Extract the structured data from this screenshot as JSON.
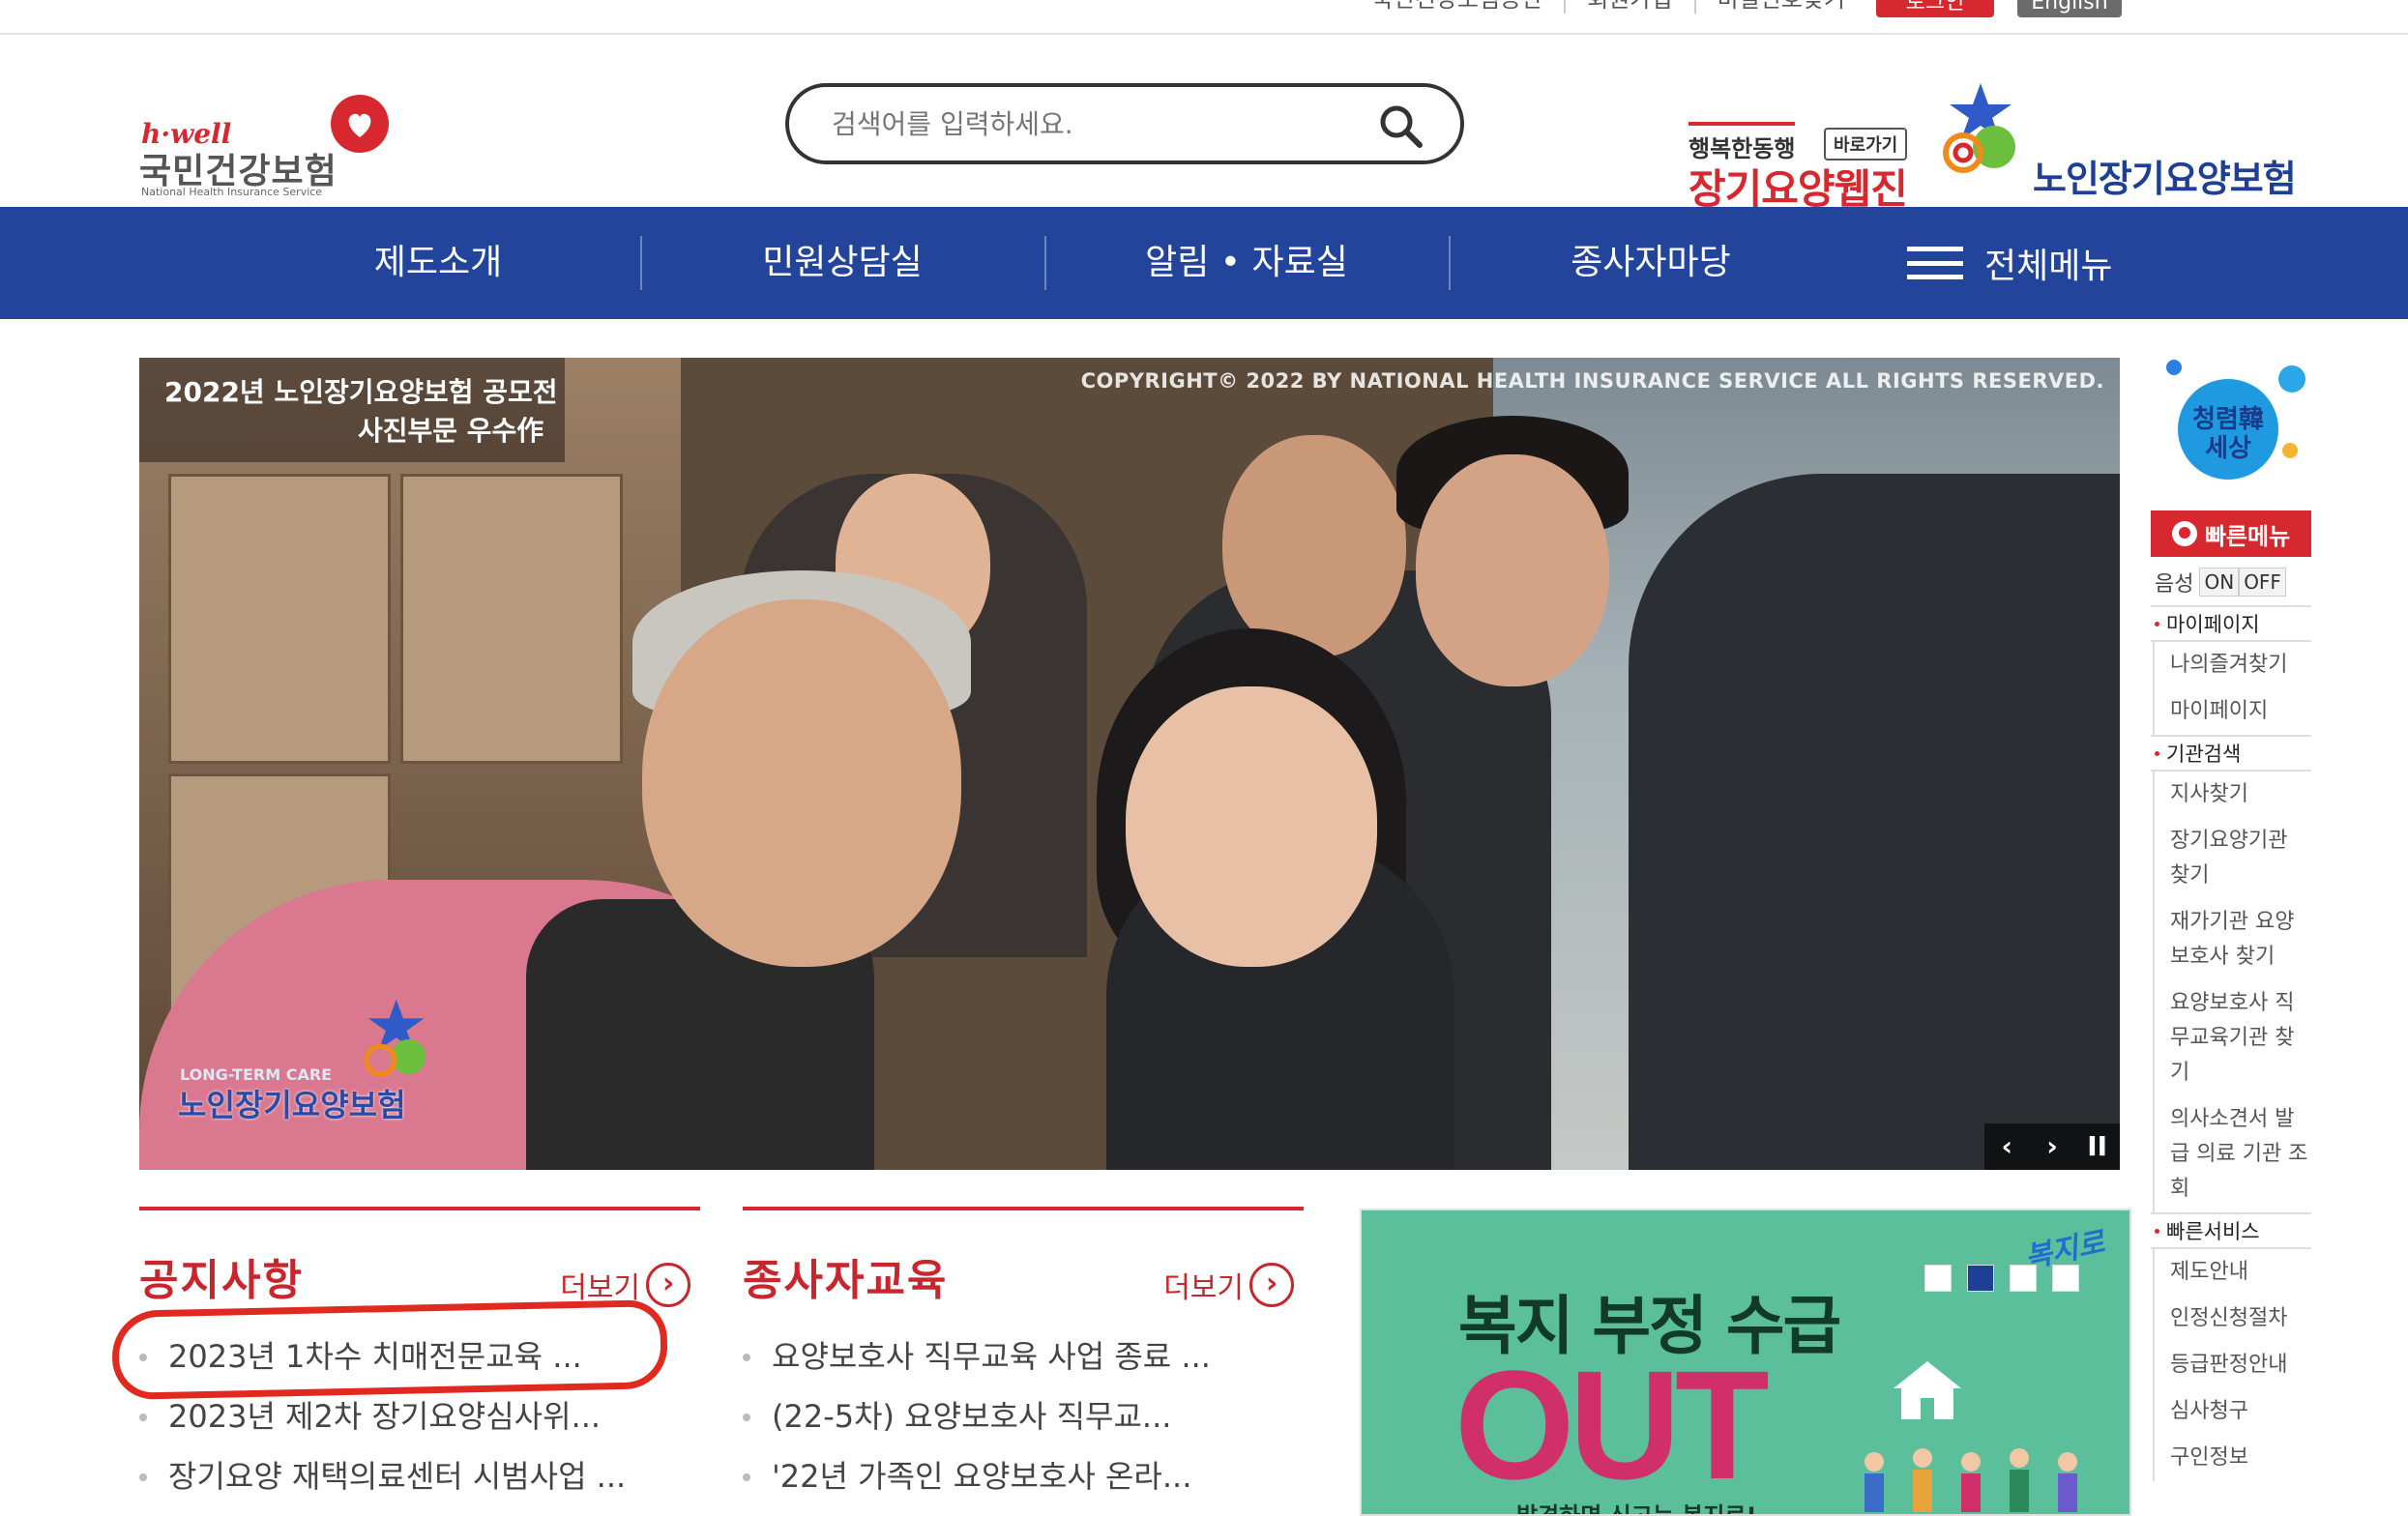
{
  "util": {
    "links": [
      "국민건강보험공단",
      "회원가입",
      "비밀번호찾기"
    ],
    "login_label": "로그인",
    "english_label": "English"
  },
  "header": {
    "logo_brand": "h·well",
    "logo_name": "국민건강보험",
    "logo_sub": "National Health Insurance Service",
    "search_placeholder": "검색어를 입력하세요.",
    "ltc_web_top": "행복한동행",
    "ltc_web_badge": "바로가기",
    "ltc_web_title": "장기요양웹진",
    "ltc_logo_name": "노인장기요양보험"
  },
  "gnb": {
    "items": [
      "제도소개",
      "민원상담실",
      "알림 • 자료실",
      "종사자마당"
    ],
    "all_menu": "전체메뉴"
  },
  "visual": {
    "caption_line1": "2022년 노인장기요양보험 공모전",
    "caption_line2": "사진부문 우수作",
    "copyright": "COPYRIGHT© 2022 BY NATIONAL HEALTH INSURANCE SERVICE ALL RIGHTS RESERVED.",
    "watermark_sub": "LONG-TERM CARE",
    "watermark_title": "노인장기요양보험",
    "ctrl_prev": "‹",
    "ctrl_next": "›",
    "ctrl_pause": "II"
  },
  "notice": {
    "title": "공지사항",
    "more": "더보기",
    "items": [
      "2023년 1차수 치매전문교육 ...",
      "2023년 제2차 장기요양심사위...",
      "장기요양 재택의료센터 시범사업 ..."
    ]
  },
  "education": {
    "title": "종사자교육",
    "more": "더보기",
    "items": [
      "요양보호사 직무교육 사업 종료 ...",
      "(22-5차) 요양보호사 직무교...",
      "'22년 가족인 요양보호사 온라..."
    ]
  },
  "banner": {
    "line1": "복지 부정 수급",
    "line2": "OUT",
    "line3": "발견하면 신고는 복지로!",
    "logo": "복지로"
  },
  "quick": {
    "cheong_text": "청렴韓 세상",
    "header": "빠른메뉴",
    "voice_label": "음성",
    "voice_on": "ON",
    "voice_off": "OFF",
    "sections": [
      {
        "title": "마이페이지",
        "items": [
          "나의즐겨찾기",
          "마이페이지"
        ]
      },
      {
        "title": "기관검색",
        "items": [
          "지사찾기",
          "장기요양기관 찾기",
          "재가기관 요양보호사 찾기",
          "요양보호사 직무교육기관 찾기",
          "의사소견서 발급 의료 기관 조회"
        ]
      },
      {
        "title": "빠른서비스",
        "items": [
          "제도안내",
          "인정신청절차",
          "등급판정안내",
          "심사청구",
          "구인정보"
        ]
      }
    ]
  },
  "colors": {
    "brand_red": "#d6282e",
    "nav_blue": "#22449b",
    "highlight_red": "#e02a1f",
    "banner_green": "#5cbf9c",
    "banner_pink": "#d02f6a"
  }
}
